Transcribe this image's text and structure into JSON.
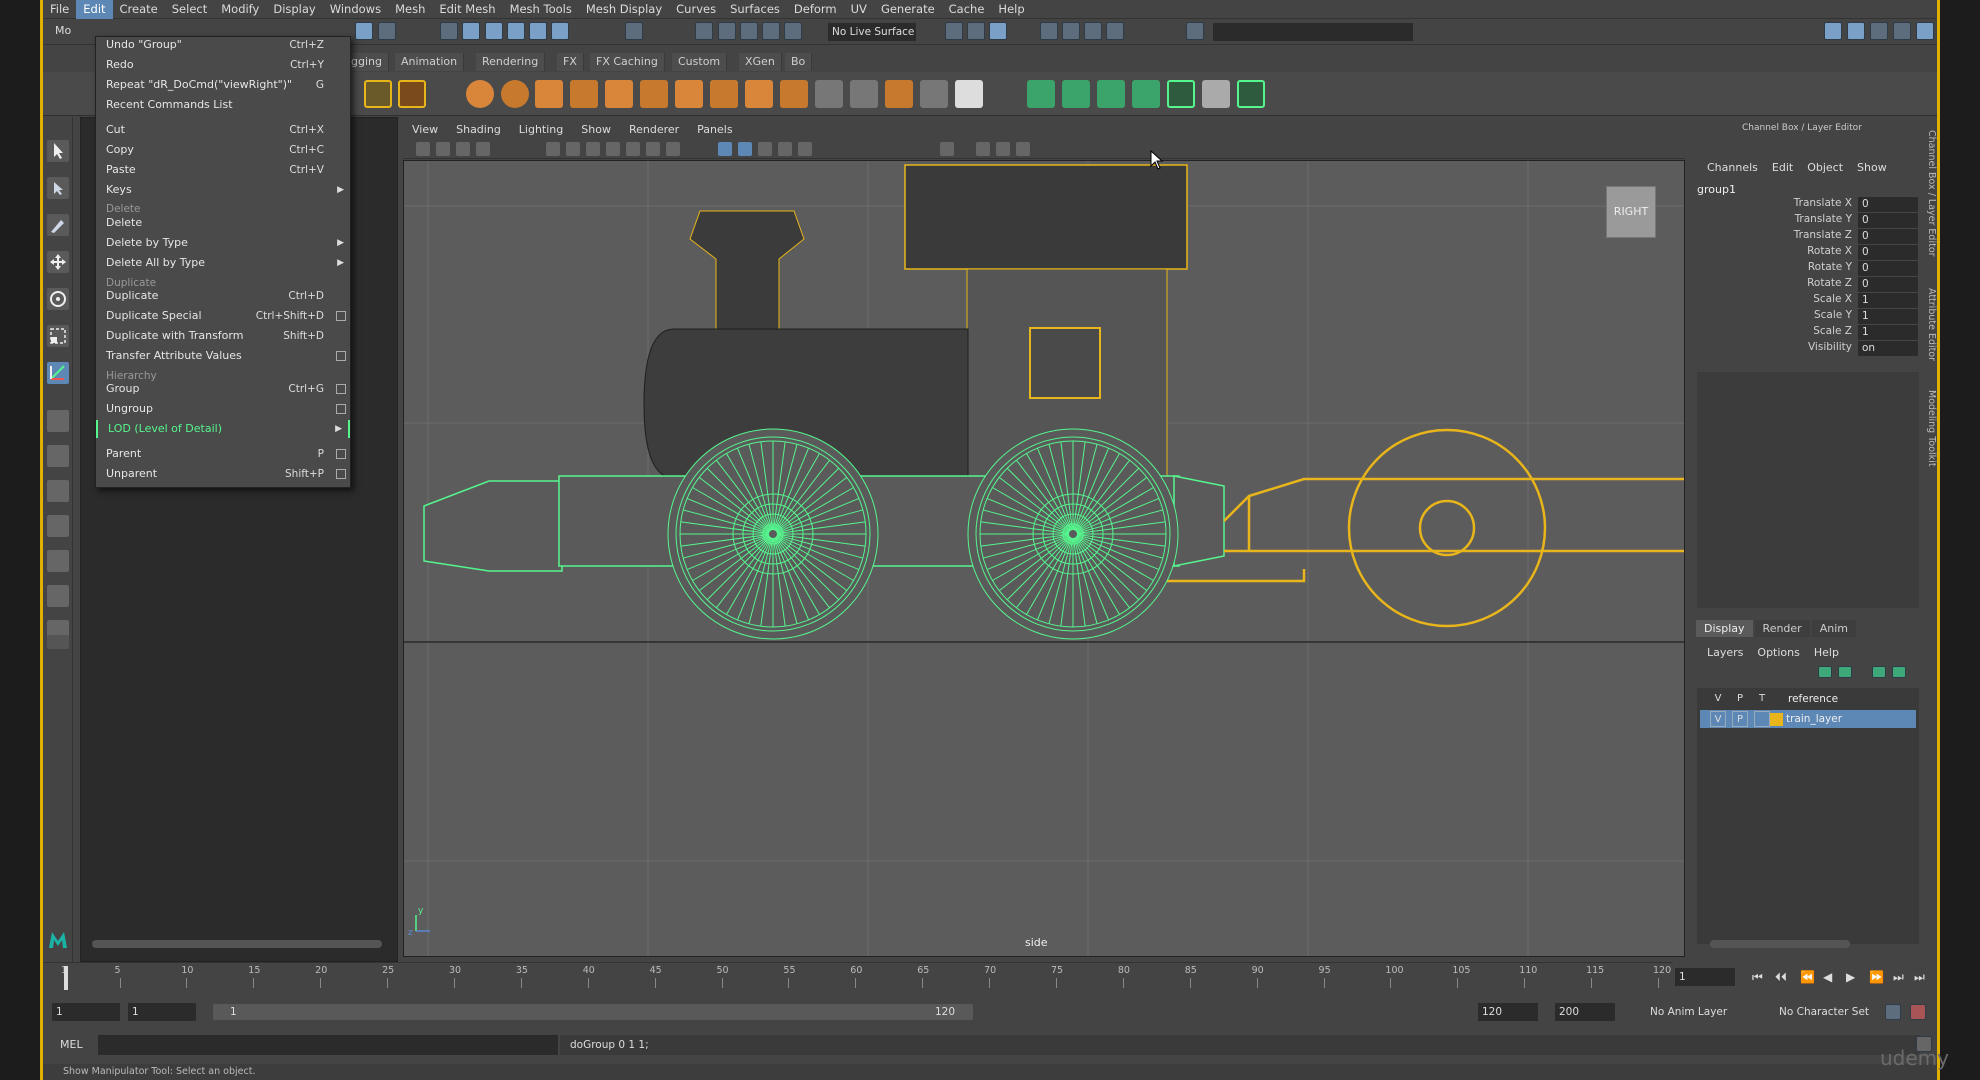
{
  "menubar": {
    "items": [
      "File",
      "Edit",
      "Create",
      "Select",
      "Modify",
      "Display",
      "Windows",
      "Mesh",
      "Edit Mesh",
      "Mesh Tools",
      "Mesh Display",
      "Curves",
      "Surfaces",
      "Deform",
      "UV",
      "Generate",
      "Cache",
      "Help"
    ],
    "active": "Edit"
  },
  "statusline": {
    "mode_abbrev": "Mo",
    "live_surface": "No Live Surface"
  },
  "shelf": {
    "tabs": [
      "gging",
      "Animation",
      "Rendering",
      "FX",
      "FX Caching",
      "Custom",
      "XGen",
      "Bo"
    ]
  },
  "edit_menu": {
    "items": [
      {
        "label": "Undo \"Group\"",
        "shortcut": "Ctrl+Z"
      },
      {
        "label": "Redo",
        "shortcut": "Ctrl+Y"
      },
      {
        "label": "Repeat \"dR_DoCmd(\"viewRight\")\"",
        "shortcut": "G"
      },
      {
        "label": "Recent Commands List",
        "shortcut": ""
      },
      {
        "label": "Cut",
        "shortcut": "Ctrl+X"
      },
      {
        "label": "Copy",
        "shortcut": "Ctrl+C"
      },
      {
        "label": "Paste",
        "shortcut": "Ctrl+V"
      },
      {
        "label": "Keys",
        "shortcut": ""
      },
      {
        "label": "Delete",
        "shortcut": ""
      },
      {
        "label": "Delete by Type",
        "shortcut": ""
      },
      {
        "label": "Delete All by Type",
        "shortcut": ""
      },
      {
        "label": "Duplicate",
        "shortcut": "Ctrl+D"
      },
      {
        "label": "Duplicate Special",
        "shortcut": "Ctrl+Shift+D"
      },
      {
        "label": "Duplicate with Transform",
        "shortcut": "Shift+D"
      },
      {
        "label": "Transfer Attribute Values",
        "shortcut": ""
      },
      {
        "label": "Group",
        "shortcut": "Ctrl+G"
      },
      {
        "label": "Ungroup",
        "shortcut": ""
      },
      {
        "label": "LOD (Level of Detail)",
        "shortcut": ""
      },
      {
        "label": "Parent",
        "shortcut": "P"
      },
      {
        "label": "Unparent",
        "shortcut": "Shift+P"
      }
    ],
    "sections": [
      "Delete",
      "Duplicate",
      "Hierarchy"
    ]
  },
  "viewport": {
    "menu": [
      "View",
      "Shading",
      "Lighting",
      "Show",
      "Renderer",
      "Panels"
    ],
    "camera_label": "side",
    "view_cube": "RIGHT"
  },
  "channel_box": {
    "title": "Channel Box / Layer Editor",
    "menu": [
      "Channels",
      "Edit",
      "Object",
      "Show"
    ],
    "object_name": "group1",
    "channels": [
      {
        "name": "Translate X",
        "value": "0"
      },
      {
        "name": "Translate Y",
        "value": "0"
      },
      {
        "name": "Translate Z",
        "value": "0"
      },
      {
        "name": "Rotate X",
        "value": "0"
      },
      {
        "name": "Rotate Y",
        "value": "0"
      },
      {
        "name": "Rotate Z",
        "value": "0"
      },
      {
        "name": "Scale X",
        "value": "1"
      },
      {
        "name": "Scale Y",
        "value": "1"
      },
      {
        "name": "Scale Z",
        "value": "1"
      },
      {
        "name": "Visibility",
        "value": "on"
      }
    ]
  },
  "layer_editor": {
    "tabs": [
      "Display",
      "Render",
      "Anim"
    ],
    "active_tab": "Display",
    "menu": [
      "Layers",
      "Options",
      "Help"
    ],
    "header": {
      "v": "V",
      "p": "P",
      "t": "T",
      "name": "reference"
    },
    "layers": [
      {
        "v": "V",
        "p": "P",
        "name": "train_layer",
        "color": "#e8b51a"
      }
    ]
  },
  "side_tabs": [
    "Channel Box / Layer Editor",
    "Attribute Editor",
    "Modeling Toolkit"
  ],
  "timeline": {
    "ticks": [
      "5",
      "10",
      "15",
      "20",
      "25",
      "30",
      "35",
      "40",
      "45",
      "50",
      "55",
      "60",
      "65",
      "70",
      "75",
      "80",
      "85",
      "90",
      "95",
      "100",
      "105",
      "110",
      "115",
      "120"
    ],
    "start_tick": "1",
    "current_frame": "1"
  },
  "range": {
    "start": "1",
    "current_start": "1",
    "slider_start": "1",
    "slider_end": "120",
    "end": "120",
    "max": "200",
    "anim_layer": "No Anim Layer",
    "character_set": "No Character Set"
  },
  "command_line": {
    "language": "MEL",
    "result": "doGroup 0 1 1;"
  },
  "help_line": "Show Manipulator Tool: Select an object.",
  "watermark": "udemy",
  "colors": {
    "selection_blue": "#5d87b5",
    "wire_green": "#56f58e",
    "wire_yellow": "#e8b51a",
    "frame_yellow": "#e0b000"
  }
}
